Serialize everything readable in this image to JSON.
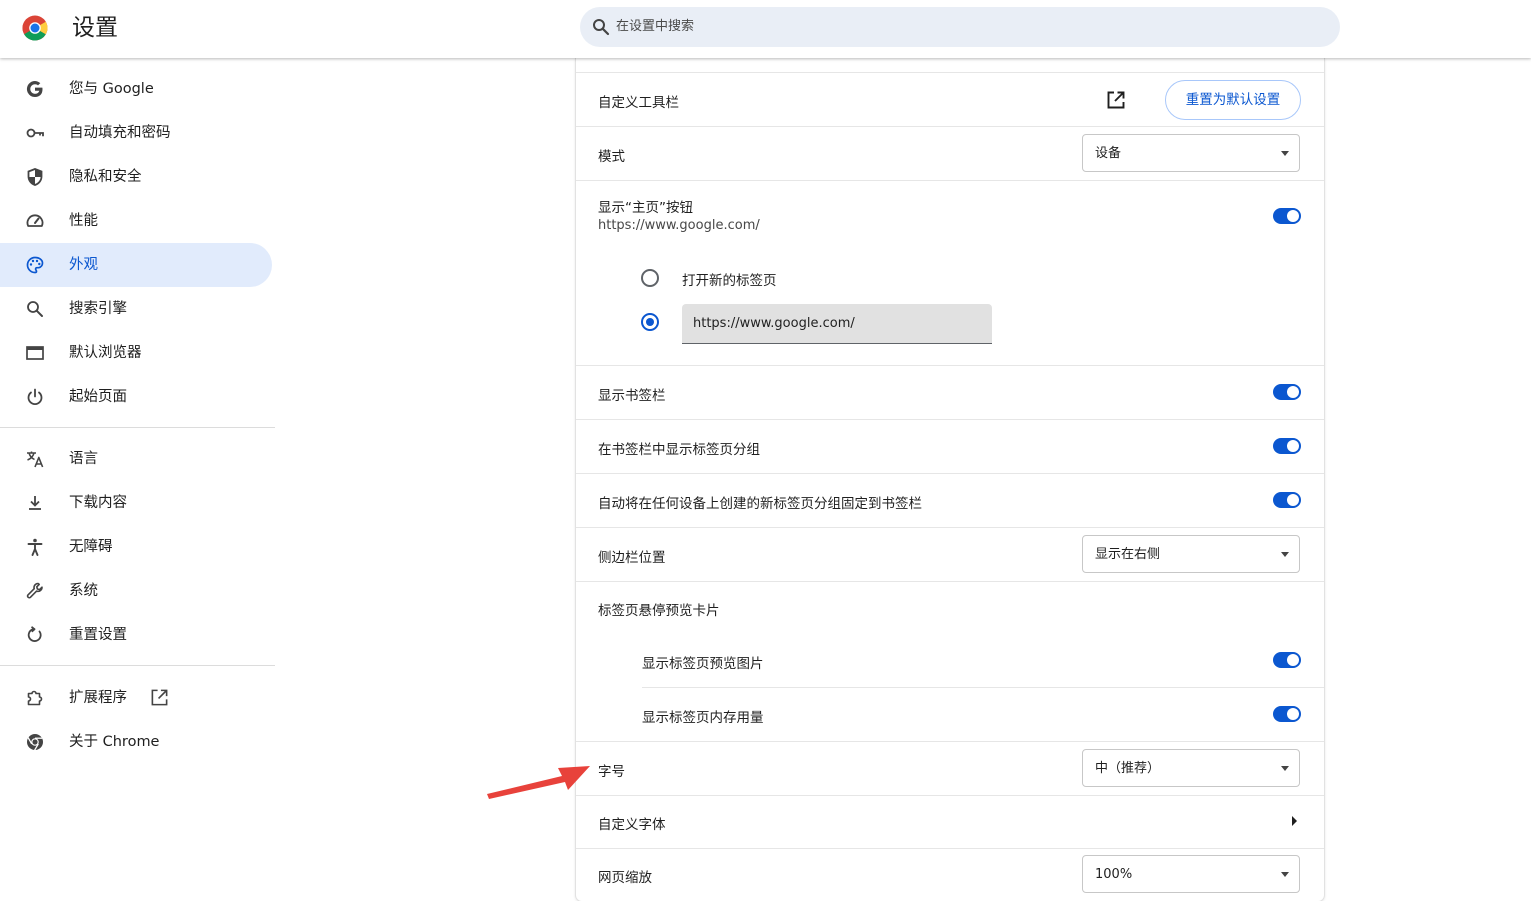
{
  "header": {
    "title": "设置",
    "search_placeholder": "在设置中搜索"
  },
  "sidebar": {
    "items": [
      {
        "label": "您与 Google",
        "icon": "google-g-icon"
      },
      {
        "label": "自动填充和密码",
        "icon": "key-icon"
      },
      {
        "label": "隐私和安全",
        "icon": "shield-icon"
      },
      {
        "label": "性能",
        "icon": "speedometer-icon"
      },
      {
        "label": "外观",
        "icon": "palette-icon",
        "active": true
      },
      {
        "label": "搜索引擎",
        "icon": "search-icon"
      },
      {
        "label": "默认浏览器",
        "icon": "browser-window-icon"
      },
      {
        "label": "起始页面",
        "icon": "power-icon"
      },
      {
        "label": "语言",
        "icon": "translate-icon"
      },
      {
        "label": "下载内容",
        "icon": "download-icon"
      },
      {
        "label": "无障碍",
        "icon": "accessibility-icon"
      },
      {
        "label": "系统",
        "icon": "wrench-icon"
      },
      {
        "label": "重置设置",
        "icon": "reset-icon"
      },
      {
        "label": "扩展程序",
        "icon": "puzzle-icon"
      },
      {
        "label": "关于 Chrome",
        "icon": "chrome-icon"
      }
    ]
  },
  "appearance": {
    "customize_toolbar": {
      "label": "自定义工具栏",
      "reset_button": "重置为默认设置"
    },
    "mode": {
      "label": "模式",
      "value": "设备"
    },
    "home_button": {
      "label": "显示“主页”按钮",
      "sub": "https://www.google.com/",
      "enabled": true,
      "option_new_tab": "打开新的标签页",
      "option_url_value": "https://www.google.com/"
    },
    "bookmarks_bar": {
      "label": "显示书签栏",
      "enabled": true
    },
    "tab_groups_in_bookmarks": {
      "label": "在书签栏中显示标签页分组",
      "enabled": true
    },
    "auto_pin_tab_groups": {
      "label": "自动将在任何设备上创建的新标签页分组固定到书签栏",
      "enabled": true
    },
    "side_panel": {
      "label": "侧边栏位置",
      "value": "显示在右侧"
    },
    "hover_card": {
      "label": "标签页悬停预览卡片"
    },
    "hover_card_image": {
      "label": "显示标签页预览图片",
      "enabled": true
    },
    "hover_card_memory": {
      "label": "显示标签页内存用量",
      "enabled": true
    },
    "font_size": {
      "label": "字号",
      "value": "中（推荐）"
    },
    "custom_fonts": {
      "label": "自定义字体"
    },
    "page_zoom": {
      "label": "网页缩放",
      "value": "100%"
    }
  },
  "colors": {
    "accent": "#0b57d0",
    "annotation_arrow": "#e8423b"
  }
}
